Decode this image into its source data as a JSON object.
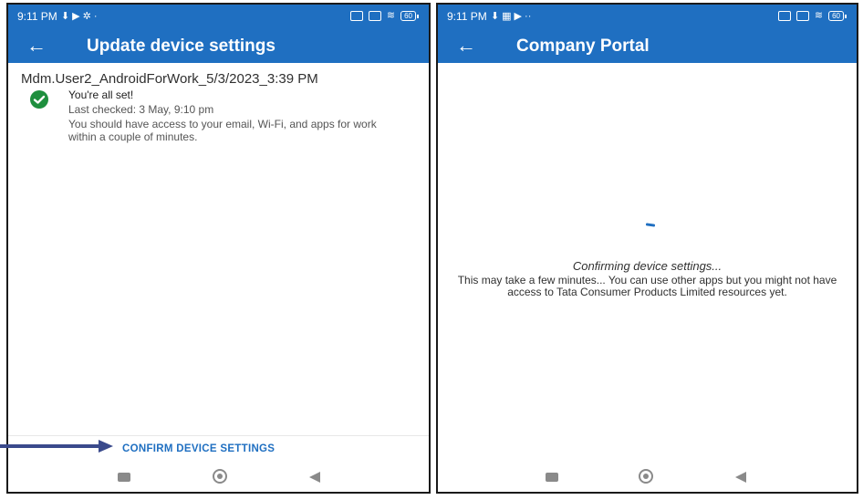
{
  "left_screen": {
    "status_bar": {
      "time": "9:11 PM",
      "left_icons": "⬇ ▶ ✲ ·",
      "battery": "60"
    },
    "app_bar": {
      "back_icon": "arrow-left-icon",
      "title": "Update device settings"
    },
    "profile_name": "Mdm.User2_AndroidForWork_5/3/2023_3:39 PM",
    "status": {
      "icon": "check-circle-icon",
      "icon_color": "#1e8f3e",
      "title": "You're all set!",
      "last_checked": "Last checked: 3 May, 9:10 pm",
      "description": "You should have access to your email, Wi-Fi, and apps for work within a couple of minutes."
    },
    "confirm_button_label": "CONFIRM DEVICE SETTINGS"
  },
  "right_screen": {
    "status_bar": {
      "time": "9:11 PM",
      "left_icons": "⬇ ▦ ▶ ··",
      "battery": "60"
    },
    "app_bar": {
      "back_icon": "arrow-left-icon",
      "title": "Company Portal"
    },
    "loading_title": "Confirming device settings...",
    "loading_message": "This may take a few minutes... You can use other apps but you might not have access to Tata Consumer Products Limited resources yet."
  },
  "colors": {
    "accent": "#1f6fc1",
    "annotation_arrow": "#3a4a8c"
  }
}
